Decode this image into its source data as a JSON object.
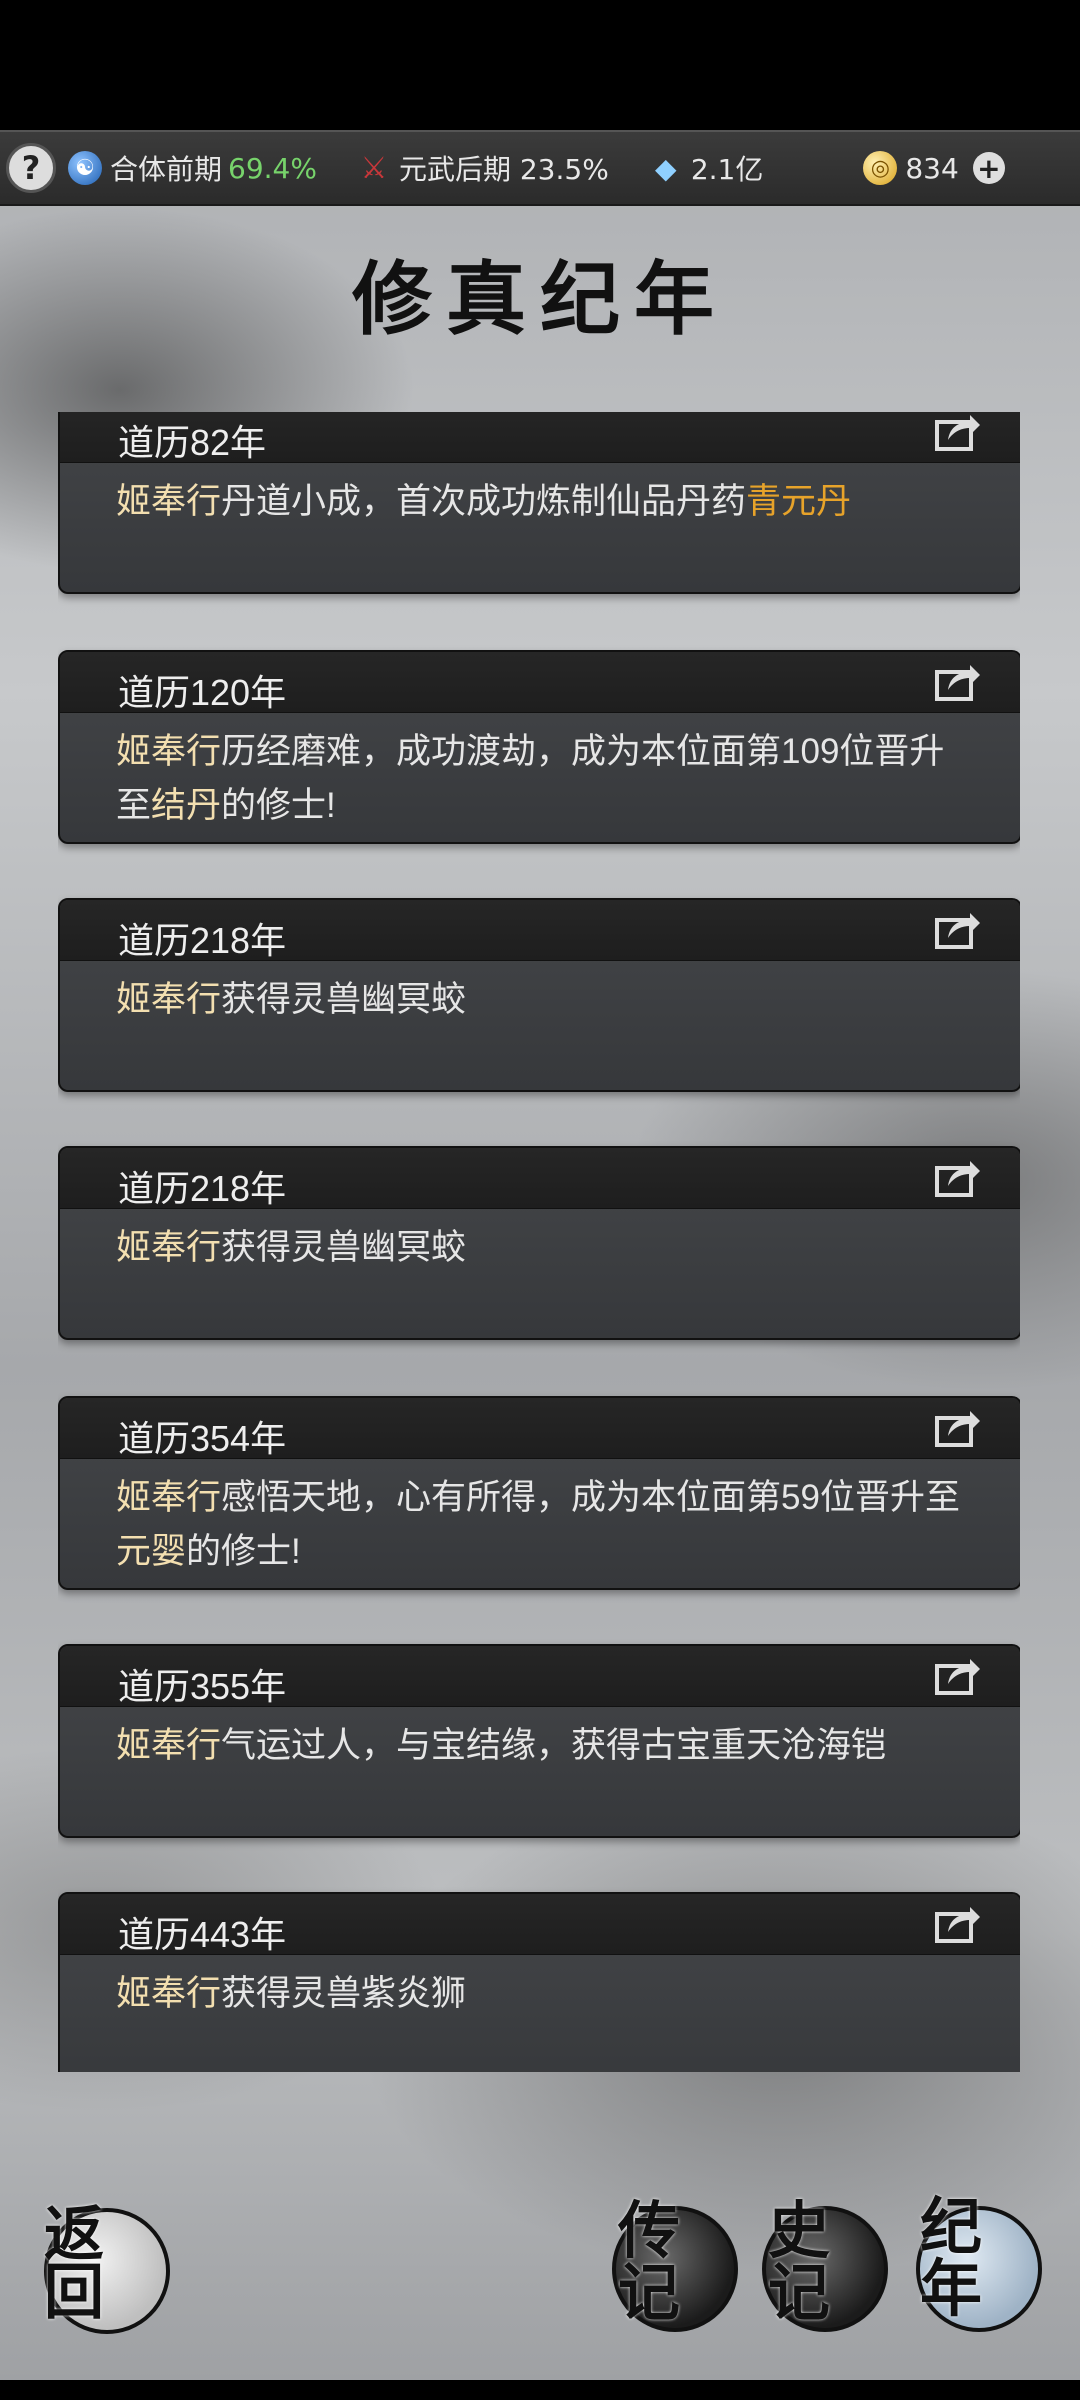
{
  "status": {
    "help_symbol": "?",
    "cultivation_label": "合体前期",
    "cultivation_pct": "69.4%",
    "martial_label": "元武后期 23.5%",
    "spirit_stones": "2.1亿",
    "jade_count": "834",
    "plus_symbol": "+"
  },
  "page": {
    "title": "修真纪年"
  },
  "entries": [
    {
      "date": "道历82年",
      "name": "姬奉行",
      "text": "丹道小成，首次成功炼制仙品丹药",
      "highlight": "青元丹",
      "tail": ""
    },
    {
      "date": "道历120年",
      "name": "姬奉行",
      "text": "历经磨难，成功渡劫，成为本位面第109位晋升至",
      "highlight": "结丹",
      "tail": "的修士!"
    },
    {
      "date": "道历218年",
      "name": "姬奉行",
      "text": "获得灵兽幽冥蛟",
      "highlight": "",
      "tail": ""
    },
    {
      "date": "道历218年",
      "name": "姬奉行",
      "text": "获得灵兽幽冥蛟",
      "highlight": "",
      "tail": ""
    },
    {
      "date": "道历354年",
      "name": "姬奉行",
      "text": "感悟天地，心有所得，成为本位面第59位晋升至",
      "highlight": "元婴",
      "tail": "的修士!"
    },
    {
      "date": "道历355年",
      "name": "姬奉行",
      "text": "气运过人，与宝结缘，获得古宝重天沧海铠",
      "highlight": "",
      "tail": ""
    },
    {
      "date": "道历443年",
      "name": "姬奉行",
      "text": "获得灵兽紫炎狮",
      "highlight": "",
      "tail": ""
    }
  ],
  "nav": {
    "back": "返回",
    "biography": "传记",
    "history": "史记",
    "chronicle": "纪年"
  }
}
